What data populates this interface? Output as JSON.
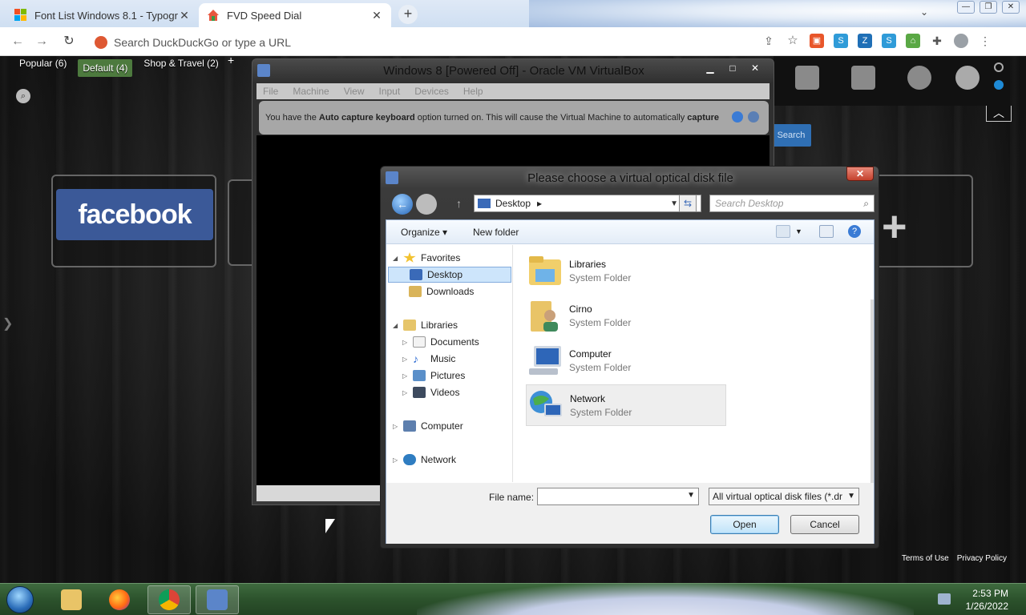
{
  "browser": {
    "tabs": [
      {
        "title": "Font List Windows 8.1 - Typogra",
        "active": false
      },
      {
        "title": "FVD Speed Dial",
        "active": true
      }
    ],
    "close_glyph": "✕",
    "new_tab_glyph": "+",
    "omnibox_placeholder": "Search DuckDuckGo or type a URL",
    "window_buttons": [
      "—",
      "❐",
      "✕"
    ]
  },
  "speed_dial": {
    "groups": [
      {
        "label": "Popular (6)",
        "active": false
      },
      {
        "label": "Default (4)",
        "active": true
      },
      {
        "label": "Shop & Travel (2)",
        "active": false
      }
    ],
    "add_group": "+",
    "facebook_tile": "facebook",
    "search_button": "Search",
    "footer_links": [
      "Terms of Use",
      "Privacy Policy"
    ]
  },
  "vbox": {
    "title": "Windows 8 [Powered Off] - Oracle VM VirtualBox",
    "menu": [
      "File",
      "Machine",
      "View",
      "Input",
      "Devices",
      "Help"
    ],
    "notice_prefix": "You have the ",
    "notice_bold1": "Auto capture keyboard",
    "notice_middle": " option turned on. This will cause the Virtual Machine to automatically ",
    "notice_bold2": "capture"
  },
  "dialog": {
    "title": "Please choose a virtual optical disk file",
    "address": "Desktop",
    "search_placeholder": "Search Desktop",
    "organize": "Organize",
    "new_folder": "New folder",
    "nav": {
      "favorites": "Favorites",
      "desktop": "Desktop",
      "downloads": "Downloads",
      "libraries": "Libraries",
      "documents": "Documents",
      "music": "Music",
      "pictures": "Pictures",
      "videos": "Videos",
      "computer": "Computer",
      "network": "Network"
    },
    "items": [
      {
        "name": "Libraries",
        "type": "System Folder"
      },
      {
        "name": "Cirno",
        "type": "System Folder"
      },
      {
        "name": "Computer",
        "type": "System Folder"
      },
      {
        "name": "Network",
        "type": "System Folder"
      }
    ],
    "file_name_label": "File name:",
    "file_name_value": "",
    "file_type": "All virtual optical disk files (*.dr",
    "open_label": "Open",
    "cancel_label": "Cancel"
  },
  "taskbar": {
    "time": "2:53 PM",
    "date": "1/26/2022"
  },
  "colors": {
    "accent_green": "#4d7a3e",
    "facebook_blue": "#3b5998",
    "dialog_selection": "#cde5fb"
  }
}
